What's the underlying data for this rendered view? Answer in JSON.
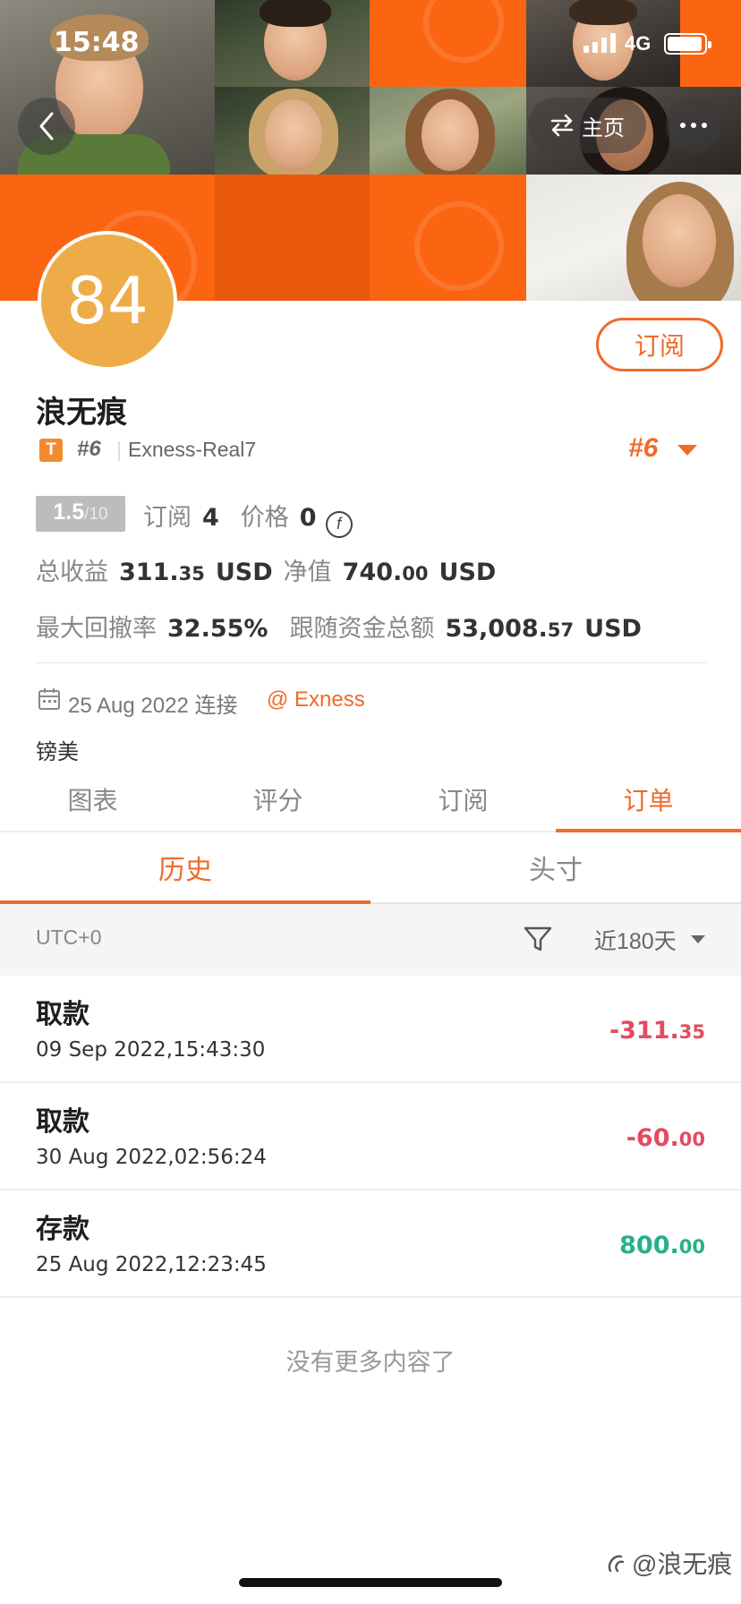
{
  "status_bar": {
    "time": "15:48",
    "network": "4G"
  },
  "nav": {
    "home_label": "主页",
    "home_swap_icon": "swap-icon",
    "back_icon": "chevron-left-icon",
    "more_icon": "more-dots-icon"
  },
  "profile": {
    "score": "84",
    "subscribe_label": "订阅",
    "name": "浪无痕",
    "tag_letter": "T",
    "rank_small": "#6",
    "server": "Exness-Real7",
    "rank_big": "#6",
    "rating_value": "1.5",
    "rating_max": "/10",
    "subscriptions_label": "订阅",
    "subscriptions_value": "4",
    "price_label": "价格",
    "price_value": "0",
    "currency_symbol": "f",
    "total_profit_label": "总收益",
    "total_profit_int": "311.",
    "total_profit_dec": "35",
    "total_profit_unit": "USD",
    "equity_label": "净值",
    "equity_int": "740.",
    "equity_dec": "00",
    "equity_unit": "USD",
    "drawdown_label": "最大回撤率",
    "drawdown_value": "32.55%",
    "follow_funds_label": "跟随资金总额",
    "follow_funds_int": "53,008.",
    "follow_funds_dec": "57",
    "follow_funds_unit": "USD",
    "connect_date": "25 Aug 2022 连接",
    "broker": "@ Exness",
    "region": "镑美"
  },
  "main_tabs": [
    {
      "label": "图表",
      "active": false
    },
    {
      "label": "评分",
      "active": false
    },
    {
      "label": "订阅",
      "active": false
    },
    {
      "label": "订单",
      "active": true
    }
  ],
  "sub_tabs": [
    {
      "label": "历史",
      "active": true
    },
    {
      "label": "头寸",
      "active": false
    }
  ],
  "filter": {
    "timezone": "UTC+0",
    "period": "近180天"
  },
  "records": [
    {
      "type": "取款",
      "time": "09 Sep 2022,15:43:30",
      "amount_int": "-311.",
      "amount_dec": "35",
      "color": "#e34b5f"
    },
    {
      "type": "取款",
      "time": "30 Aug 2022,02:56:24",
      "amount_int": "-60.",
      "amount_dec": "00",
      "color": "#e34b5f"
    },
    {
      "type": "存款",
      "time": "25 Aug 2022,12:23:45",
      "amount_int": "800.",
      "amount_dec": "00",
      "color": "#26b08a"
    }
  ],
  "no_more": "没有更多内容了",
  "watermark": "@浪无痕",
  "colors": {
    "accent": "#f06a2a",
    "negative": "#e34b5f",
    "positive": "#26b08a",
    "score_bg": "#eeac49"
  }
}
